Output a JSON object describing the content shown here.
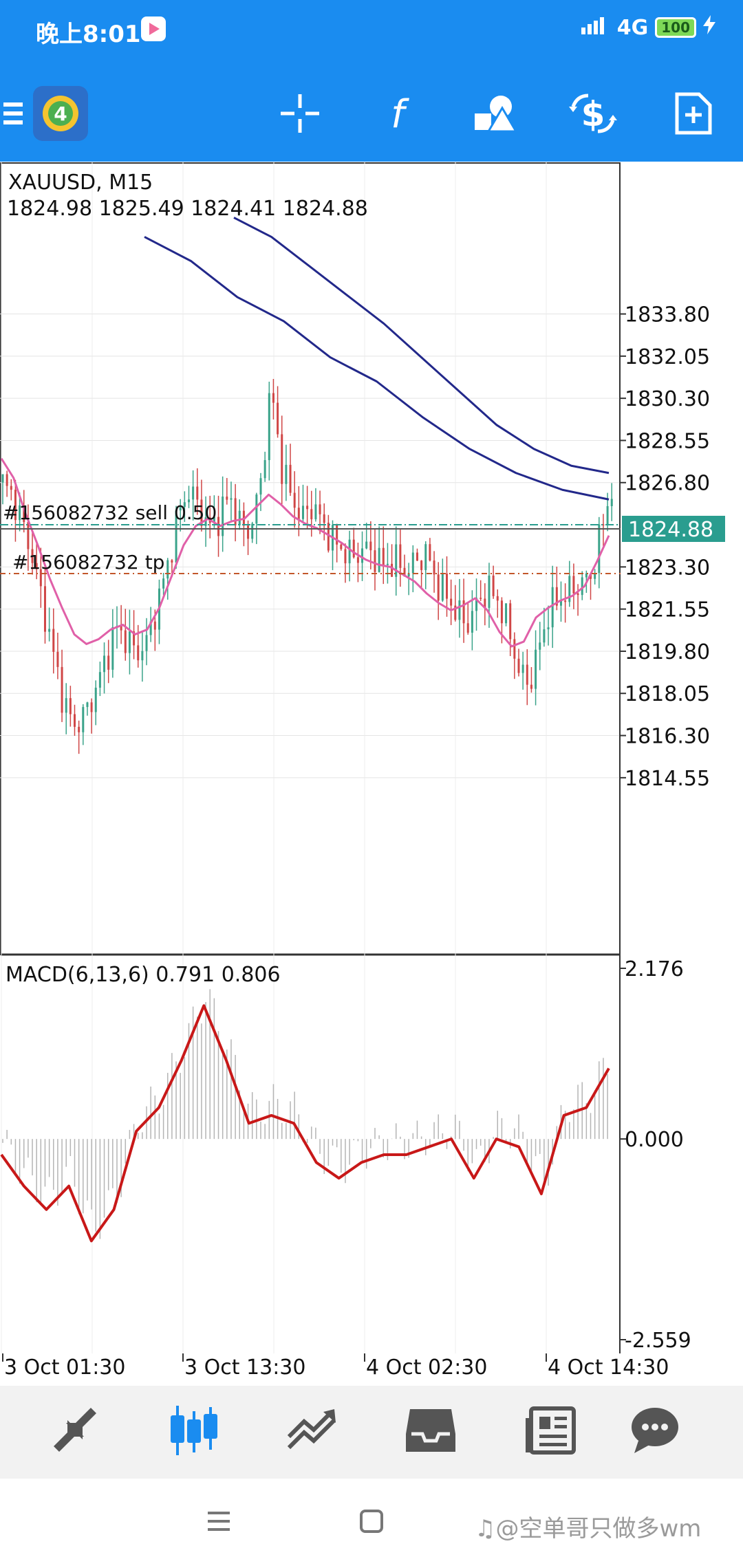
{
  "status": {
    "time": "晚上8:01",
    "network": "4G",
    "battery": "100"
  },
  "chart": {
    "symbol_timeframe": "XAUUSD, M15",
    "ohlc": "1824.98 1825.49 1824.41 1824.88",
    "current_price": "1824.88",
    "order_sell_label": "#156082732 sell  0.50",
    "order_tp_label": "#156082732 tp",
    "price_ticks": [
      "1833.80",
      "1832.05",
      "1830.30",
      "1828.55",
      "1826.80",
      "1823.30",
      "1821.55",
      "1819.80",
      "1818.05",
      "1816.30",
      "1814.55"
    ],
    "macd_label": "MACD(6,13,6) 0.791 0.806",
    "macd_ticks": [
      "2.176",
      "0.000",
      "-2.559"
    ],
    "time_ticks": [
      "3 Oct 01:30",
      "3 Oct 13:30",
      "4 Oct 02:30",
      "4 Oct 14:30"
    ]
  },
  "chart_data": {
    "type": "candlestick",
    "symbol": "XAUUSD",
    "timeframe": "M15",
    "ylim": [
      1813.5,
      1835.5
    ],
    "last_price": 1824.88,
    "sell_order_price": 1824.74,
    "tp_price": 1822.98,
    "close_path": [
      1826.8,
      1826.2,
      1825.0,
      1823.5,
      1821.5,
      1819.5,
      1817.5,
      1816.7,
      1817.2,
      1818.2,
      1819.5,
      1820.8,
      1820.3,
      1819.7,
      1820.2,
      1821.8,
      1823.4,
      1825.5,
      1826.5,
      1825.8,
      1824.9,
      1825.4,
      1826.3,
      1825.0,
      1824.8,
      1826.8,
      1830.8,
      1827.5,
      1826.2,
      1825.3,
      1825.9,
      1825.1,
      1824.4,
      1824.0,
      1823.7,
      1824.1,
      1823.8,
      1823.3,
      1823.6,
      1823.1,
      1823.5,
      1823.9,
      1822.7,
      1822.1,
      1821.4,
      1820.9,
      1821.8,
      1822.4,
      1821.9,
      1820.8,
      1819.0,
      1818.4,
      1820.0,
      1821.6,
      1822.0,
      1822.3,
      1822.6,
      1822.9,
      1824.8,
      1826.6,
      1824.9
    ],
    "ma_pink": [
      1827.8,
      1827.0,
      1825.5,
      1824.2,
      1822.8,
      1821.6,
      1820.5,
      1820.1,
      1820.3,
      1820.7,
      1820.9,
      1820.5,
      1820.7,
      1821.6,
      1822.9,
      1824.2,
      1825.0,
      1825.3,
      1825.0,
      1825.2,
      1825.3,
      1825.8,
      1826.3,
      1825.9,
      1825.4,
      1825.1,
      1824.9,
      1824.6,
      1824.3,
      1823.9,
      1823.6,
      1823.4,
      1823.3,
      1823.0,
      1822.7,
      1822.2,
      1821.8,
      1821.5,
      1821.7,
      1822.0,
      1821.5,
      1820.6,
      1820.0,
      1820.2,
      1821.2,
      1821.6,
      1821.9,
      1822.1,
      1822.5,
      1823.5,
      1824.6
    ],
    "ma_navy_1": [
      1837.0,
      1836.0,
      1834.5,
      1833.5,
      1832.0,
      1831.0,
      1829.5,
      1828.2,
      1827.2,
      1826.5,
      1826.1
    ],
    "ma_navy_2": [
      1837.8,
      1837.0,
      1835.8,
      1834.6,
      1833.4,
      1832.0,
      1830.6,
      1829.2,
      1828.2,
      1827.5,
      1827.2
    ],
    "macd": {
      "ylim": [
        -2.559,
        2.176
      ],
      "signal": [
        -0.2,
        -0.6,
        -0.9,
        -0.6,
        -1.3,
        -0.9,
        0.1,
        0.4,
        1.0,
        1.7,
        1.0,
        0.2,
        0.3,
        0.2,
        -0.3,
        -0.5,
        -0.3,
        -0.2,
        -0.2,
        -0.1,
        0.0,
        -0.5,
        0.0,
        -0.1,
        -0.7,
        0.3,
        0.4,
        0.9
      ]
    },
    "x_ticks": [
      "3 Oct 01:30",
      "3 Oct 13:30",
      "4 Oct 02:30",
      "4 Oct 14:30"
    ]
  },
  "colors": {
    "header_blue": "#1a8cf0",
    "bull_candle": "#3aa38a",
    "bear_candle": "#d04646",
    "ma_pink": "#e060a8",
    "ma_navy": "#22288a",
    "macd_signal": "#c81818",
    "price_label_bg": "#2a9d8f"
  },
  "icons": {
    "menu": "hamburger-icon",
    "app": "mt4-logo-icon",
    "crosshair": "crosshair-icon",
    "indicator": "function-icon",
    "objects": "shapes-icon",
    "trade": "dollar-arrows-icon",
    "new_order": "new-document-icon"
  }
}
